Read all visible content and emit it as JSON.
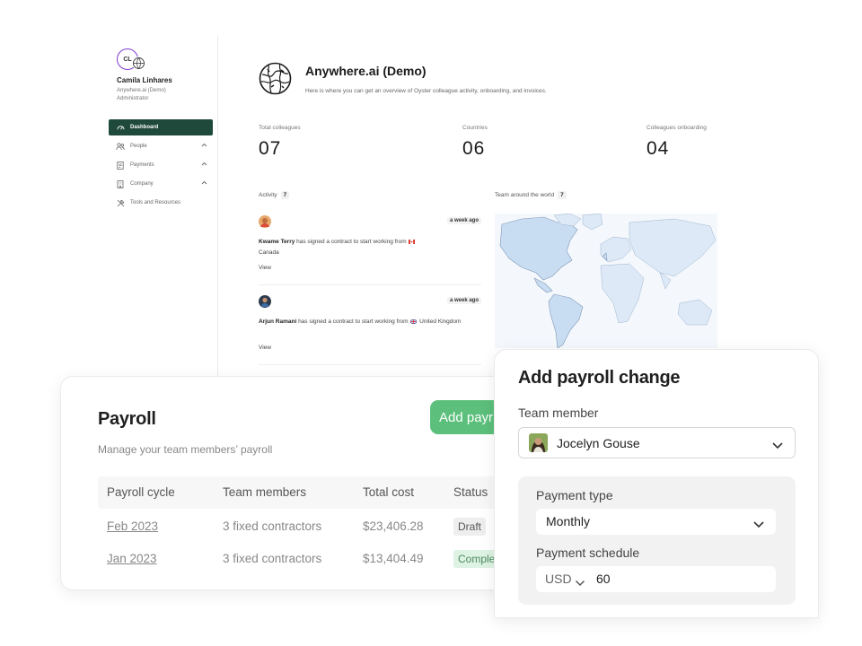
{
  "dashboard": {
    "user": {
      "initials": "CL",
      "name": "Camila Linhares",
      "org": "Anywhere.ai (Demo)",
      "role": "Administrator"
    },
    "nav": [
      {
        "label": "Dashboard",
        "icon": "gauge-icon",
        "active": true
      },
      {
        "label": "People",
        "icon": "people-icon",
        "expandable": true
      },
      {
        "label": "Payments",
        "icon": "document-icon",
        "expandable": true
      },
      {
        "label": "Company",
        "icon": "building-icon",
        "expandable": true
      },
      {
        "label": "Tools and Resources",
        "icon": "tools-icon"
      }
    ],
    "title": "Anywhere.ai (Demo)",
    "subtitle": "Here is where you can get an overview of Oyster colleague activity, onboarding, and invoices.",
    "stats": [
      {
        "label": "Total colleagues",
        "value": "07"
      },
      {
        "label": "Countries",
        "value": "06"
      },
      {
        "label": "Colleagues onboarding",
        "value": "04"
      }
    ],
    "activity": {
      "label": "Activity",
      "count": "7",
      "items": [
        {
          "name": "Kwame Terry",
          "text": " has signed a contract to start working from ",
          "country": "Canada",
          "time": "a week ago",
          "view": "View"
        },
        {
          "name": "Arjun Ramani",
          "text": " has signed a contract to start working from ",
          "country": "United Kingdom",
          "time": "a week ago",
          "view": "View"
        }
      ]
    },
    "team_map": {
      "label": "Team around the world",
      "count": "7"
    }
  },
  "payroll": {
    "title": "Payroll",
    "subtitle": "Manage your team members’ payroll",
    "add_button": "Add payr",
    "columns": [
      "Payroll cycle",
      "Team members",
      "Total cost",
      "Status"
    ],
    "rows": [
      {
        "cycle": "Feb 2023",
        "members": "3 fixed contractors",
        "cost": "$23,406.28",
        "status": "Draft"
      },
      {
        "cycle": "Jan 2023",
        "members": "3 fixed contractors",
        "cost": "$13,404.49",
        "status": "Comple"
      }
    ],
    "colors": {
      "button": "#5cbf7b",
      "draft_bg": "#eeeeee",
      "complete_bg": "#dff3e4"
    }
  },
  "payroll_change": {
    "title": "Add payroll change",
    "team_member_label": "Team member",
    "team_member_value": "Jocelyn Gouse",
    "payment_type_label": "Payment type",
    "payment_type_value": "Monthly",
    "payment_schedule_label": "Payment schedule",
    "currency": "USD",
    "amount": "60"
  }
}
